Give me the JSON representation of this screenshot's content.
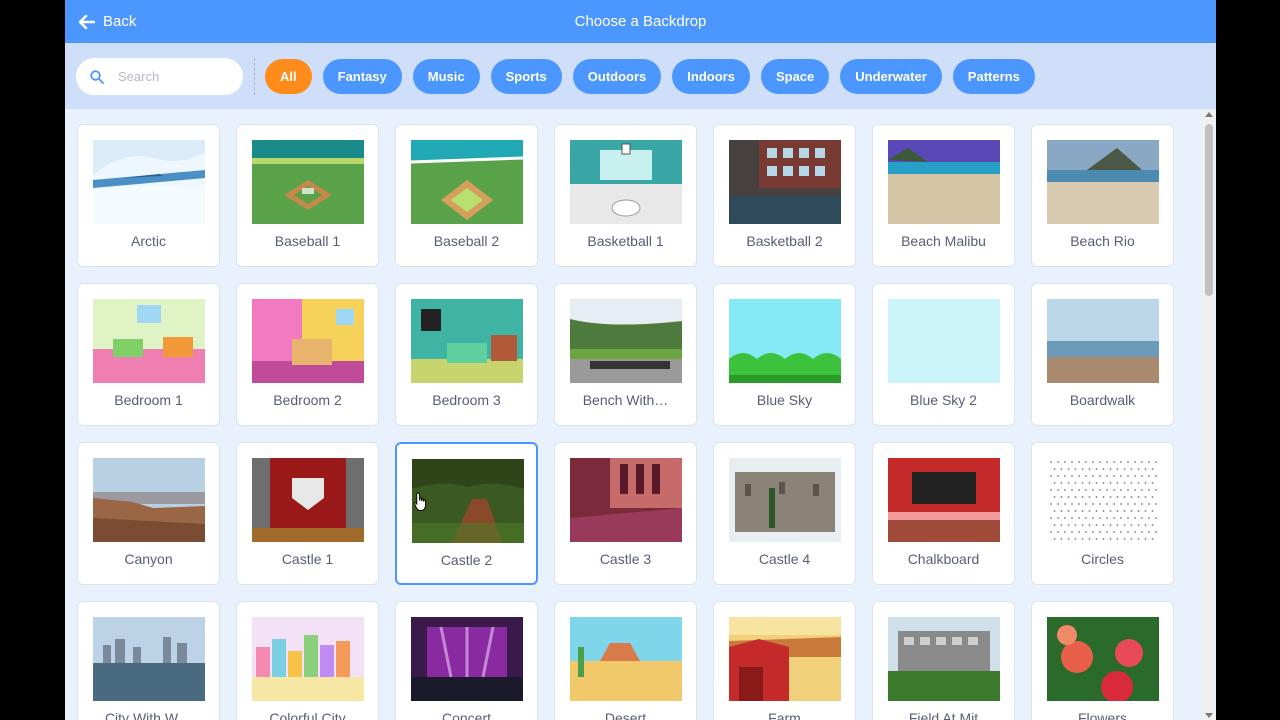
{
  "header": {
    "back_label": "Back",
    "title": "Choose a Backdrop",
    "back_icon": "arrow-left-icon"
  },
  "search": {
    "placeholder": "Search",
    "icon": "search-icon"
  },
  "tags": [
    {
      "label": "All",
      "active": true
    },
    {
      "label": "Fantasy",
      "active": false
    },
    {
      "label": "Music",
      "active": false
    },
    {
      "label": "Sports",
      "active": false
    },
    {
      "label": "Outdoors",
      "active": false
    },
    {
      "label": "Indoors",
      "active": false
    },
    {
      "label": "Space",
      "active": false
    },
    {
      "label": "Underwater",
      "active": false
    },
    {
      "label": "Patterns",
      "active": false
    }
  ],
  "backdrops": [
    {
      "label": "Arctic",
      "key": "arctic"
    },
    {
      "label": "Baseball 1",
      "key": "baseball1"
    },
    {
      "label": "Baseball 2",
      "key": "baseball2"
    },
    {
      "label": "Basketball 1",
      "key": "basketball1"
    },
    {
      "label": "Basketball 2",
      "key": "basketball2"
    },
    {
      "label": "Beach Malibu",
      "key": "beachmalibu"
    },
    {
      "label": "Beach Rio",
      "key": "beachrio"
    },
    {
      "label": "Bedroom 1",
      "key": "bedroom1"
    },
    {
      "label": "Bedroom 2",
      "key": "bedroom2"
    },
    {
      "label": "Bedroom 3",
      "key": "bedroom3"
    },
    {
      "label": "Bench With…",
      "key": "bench"
    },
    {
      "label": "Blue Sky",
      "key": "bluesky"
    },
    {
      "label": "Blue Sky 2",
      "key": "bluesky2"
    },
    {
      "label": "Boardwalk",
      "key": "boardwalk"
    },
    {
      "label": "Canyon",
      "key": "canyon"
    },
    {
      "label": "Castle 1",
      "key": "castle1"
    },
    {
      "label": "Castle 2",
      "key": "castle2",
      "hover": true
    },
    {
      "label": "Castle 3",
      "key": "castle3"
    },
    {
      "label": "Castle 4",
      "key": "castle4"
    },
    {
      "label": "Chalkboard",
      "key": "chalkboard"
    },
    {
      "label": "Circles",
      "key": "circles"
    },
    {
      "label": "City With W…",
      "key": "citywater"
    },
    {
      "label": "Colorful City",
      "key": "colorfulcity"
    },
    {
      "label": "Concert",
      "key": "concert"
    },
    {
      "label": "Desert",
      "key": "desert"
    },
    {
      "label": "Farm",
      "key": "farm"
    },
    {
      "label": "Field At Mit",
      "key": "fieldmit"
    },
    {
      "label": "Flowers",
      "key": "flowers"
    }
  ],
  "colors": {
    "header": "#4c97ff",
    "active_tag": "#ff8c1a",
    "tag": "#4c97ff",
    "filterbar": "#cfdff9",
    "background": "#e9f1fc",
    "label_text": "#575e75"
  }
}
